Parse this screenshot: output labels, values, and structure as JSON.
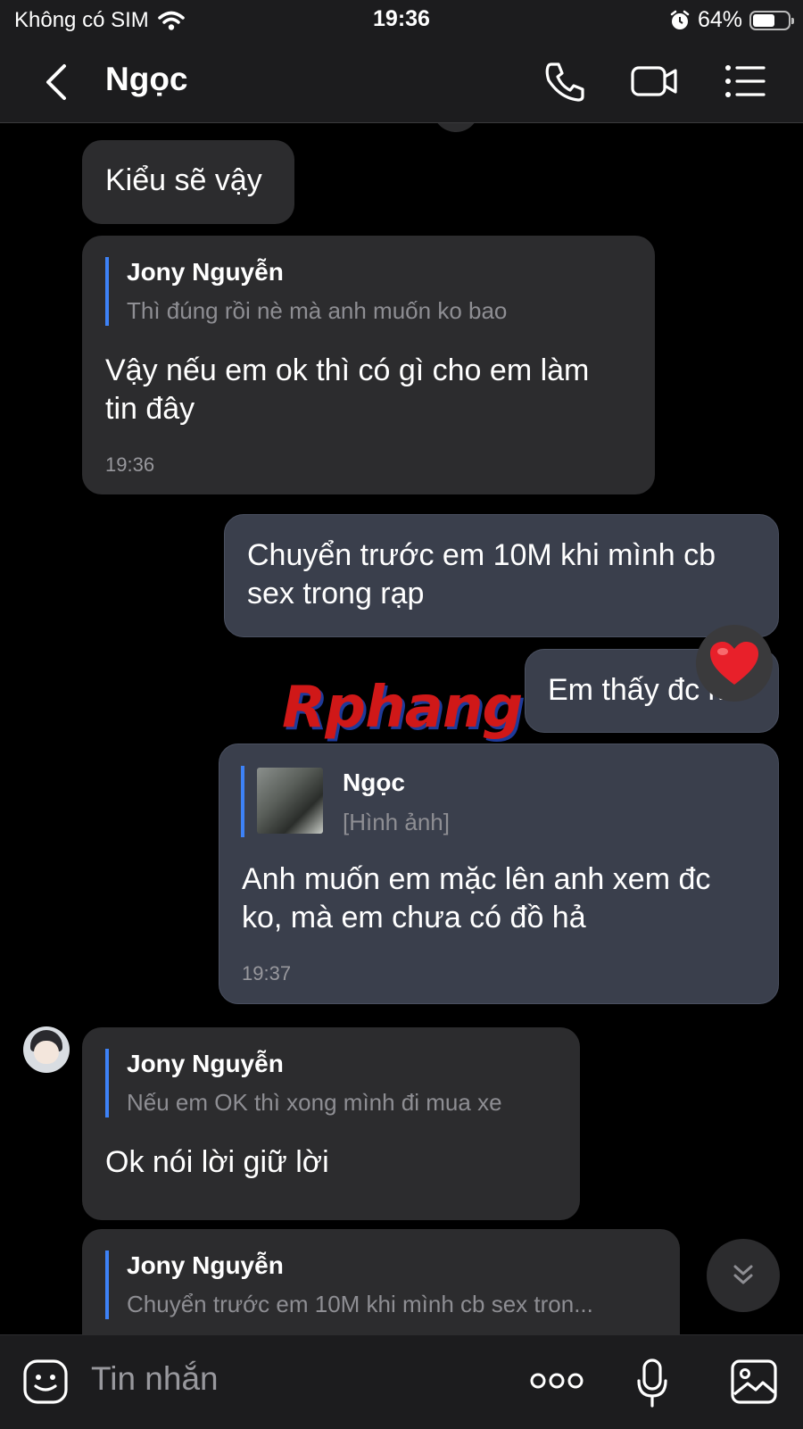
{
  "status_bar": {
    "carrier": "Không có SIM",
    "time": "19:36",
    "battery": "64%",
    "battery_level": 0.64
  },
  "header": {
    "title": "Ngọc"
  },
  "messages": {
    "m1": {
      "text": "Kiểu sẽ vậy"
    },
    "m2": {
      "quote_name": "Jony Nguyễn",
      "quote_text": "Thì đúng rồi nè mà anh muốn ko bao",
      "text_line1": "Vậy nếu em ok thì có gì cho em làm",
      "text_line2": "tin đây",
      "time": "19:36"
    },
    "m3": {
      "text_line1": "Chuyển trước em 10M khi mình cb",
      "text_line2": "sex trong rạp"
    },
    "m4": {
      "text": "Em thấy đc ko",
      "reaction": "❤️"
    },
    "m5": {
      "quote_name": "Ngọc",
      "quote_text": "[Hình ảnh]",
      "text_line1": "Anh muốn em mặc lên anh xem đc",
      "text_line2": "ko, mà em chưa có đồ hả",
      "time": "19:37"
    },
    "m6": {
      "quote_name": "Jony Nguyễn",
      "quote_text": "Nếu em OK thì xong mình đi mua xe",
      "text": "Ok nói lời giữ lời"
    },
    "m7": {
      "quote_name": "Jony Nguyễn",
      "quote_text": "Chuyển trước em 10M khi mình cb sex tron..."
    }
  },
  "watermark": "Rphang",
  "input": {
    "placeholder": "Tin nhắn"
  },
  "colors": {
    "bubble_in": "#2c2c2e",
    "bubble_out": "#3a3f4c",
    "accent": "#3d82f7",
    "bar": "#1c1c1e"
  },
  "icons": [
    "wifi-icon",
    "alarm-icon",
    "battery-icon",
    "back-icon",
    "phone-icon",
    "video-call-icon",
    "menu-icon",
    "heart-icon",
    "avatar",
    "scroll-down-icon",
    "sticker-icon",
    "more-icon",
    "mic-icon",
    "image-icon"
  ]
}
